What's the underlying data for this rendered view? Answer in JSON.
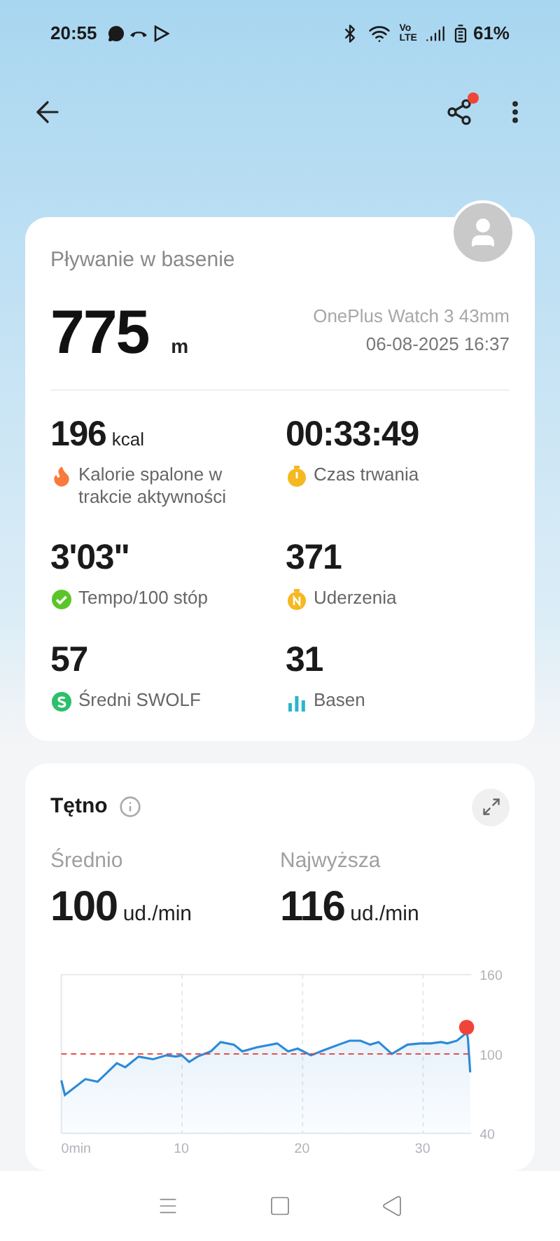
{
  "status_bar": {
    "time": "20:55",
    "network": [
      "Vo",
      "LTE"
    ],
    "battery": "61%"
  },
  "summary": {
    "title": "Pływanie w basenie",
    "distance": "775",
    "distance_unit": "m",
    "device": "OnePlus Watch 3 43mm",
    "datetime": "06-08-2025 16:37"
  },
  "metrics": [
    {
      "value": "196",
      "unit": "kcal",
      "label": "Kalorie spalone w trakcie aktywności",
      "kind": "flame",
      "color": "#f97a3c"
    },
    {
      "value": "00:33:49",
      "label": "Czas trwania",
      "kind": "timer",
      "color": "#f5b820"
    },
    {
      "value": "3'03\"",
      "label": "Tempo/100 stóp",
      "kind": "pace",
      "color": "#5ac528"
    },
    {
      "value": "371",
      "label": "Uderzenia",
      "kind": "strokes",
      "color": "#f5b820"
    },
    {
      "value": "57",
      "label": "Średni SWOLF",
      "kind": "swolf",
      "color": "#2dbf6a"
    },
    {
      "value": "31",
      "label": "Basen",
      "kind": "bars",
      "color": "#29b6c8"
    }
  ],
  "heart_rate": {
    "title": "Tętno",
    "stats": [
      {
        "label": "Średnio",
        "value": "100",
        "unit": "ud./min"
      },
      {
        "label": "Najwyższa",
        "value": "116",
        "unit": "ud./min"
      }
    ],
    "chart_data": {
      "type": "area",
      "x": [
        0,
        0.3,
        2,
        3,
        4.6,
        5.3,
        6.4,
        7.6,
        8.7,
        9.5,
        10,
        10.6,
        11.3,
        12.4,
        13.2,
        14.3,
        15,
        16.2,
        17.9,
        18.8,
        19.6,
        20.7,
        21.8,
        23,
        23.9,
        24.8,
        25.6,
        26.3,
        27.4,
        28.7,
        29.8,
        30.6,
        31.5,
        32,
        32.8,
        33.6,
        33.7,
        33.9
      ],
      "series": [
        {
          "color": "#2b8ad9",
          "values": [
            80,
            69,
            81,
            79,
            93,
            90,
            98,
            96,
            99,
            98,
            99,
            94,
            98,
            102,
            109,
            107,
            102,
            105,
            108,
            102,
            104,
            99,
            103,
            107,
            110,
            110,
            107,
            109,
            100,
            107,
            108,
            108,
            109,
            108,
            110,
            116,
            112,
            86
          ]
        }
      ],
      "xlim": [
        0,
        34
      ],
      "ylim": [
        40,
        160
      ],
      "xticks": [
        {
          "value": 0,
          "label": "0min"
        },
        10,
        20,
        30
      ],
      "yticks": [
        40,
        100,
        160
      ],
      "grid": true,
      "ref_lines": [
        {
          "axis": "y",
          "value": 100,
          "color": "#e53935"
        }
      ]
    }
  }
}
